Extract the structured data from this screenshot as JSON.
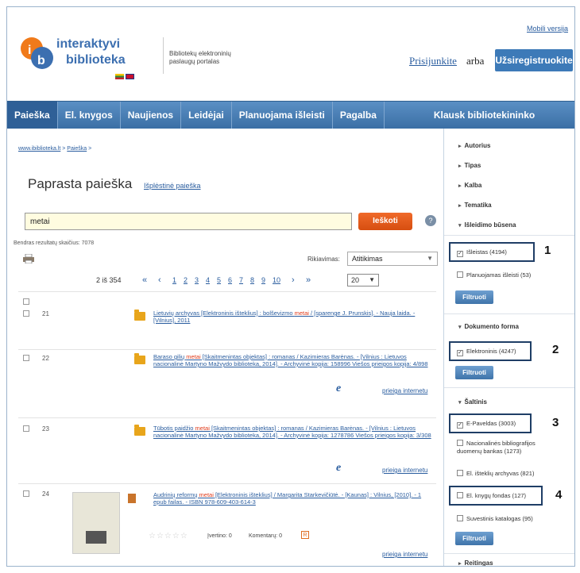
{
  "header": {
    "mobile_link": "Mobili versija",
    "logo_line1": "interaktyvi",
    "logo_line2": "biblioteka",
    "portal_text": "Bibliotekų elektroninių paslaugų portalas",
    "login_link": "Prisijunkite",
    "or_text": "arba",
    "register_button": "Užsiregistruokite"
  },
  "nav": {
    "items": [
      "Paieška",
      "El. knygos",
      "Naujienos",
      "Leidėjai",
      "Planuojama išleisti",
      "Pagalba",
      "Klausk bibliotekininko"
    ]
  },
  "breadcrumb": {
    "home": "www.ibiblioteka.lt",
    "sep": " > ",
    "current": "Paieška",
    "trail": " >"
  },
  "search": {
    "title": "Paprasta paieška",
    "advanced_link": "Išplėstinė paieška",
    "query": "metai",
    "button": "Ieškoti",
    "help": "?"
  },
  "results": {
    "total_label": "Bendras rezultatų skaičius: 7078",
    "sort_label": "Rikiavimas:",
    "sort_value": "Atitikimas",
    "pager": {
      "count": "2 iš 354",
      "first": "«",
      "prev": "‹",
      "pages": [
        "1",
        "2",
        "3",
        "4",
        "5",
        "6",
        "7",
        "8",
        "9",
        "10"
      ],
      "next": "›",
      "last": "»",
      "page_size": "20"
    },
    "rows": [
      {
        "num": "21",
        "text_before": "Lietuvių archyvas [Elektroninis išteklius] : bolševizmo ",
        "highlight": "metai",
        "text_after": " / [sparenge J. Prunskis]. - Nauja laida. - [Vilnius], 2011"
      },
      {
        "num": "22",
        "text_before": "Baraso gilių ",
        "highlight": "metai",
        "text_after": " [Skaitmenintas objektas] : romanas / Kazimieras Barėnas. - [Vilnius : Lietuvos nacionalinė Martyno Mažvydo biblioteka, 2014]. - Archyvinė kopija: 158996 Viešos prieigos kopija: 4/898",
        "source_logo": "Epaveldas",
        "net_link": "prieiga internetu"
      },
      {
        "num": "23",
        "text_before": "Tūbotis paidžio ",
        "highlight": "metai",
        "text_after": " [Skaitmenintas objektas] : romanas / Kazimieras Barėnas. - [Vilnius : Lietuvos nacionalinė Martyno Mažvydo biblioteka, 2014]. - Archyvinė kopija: 1278786 Viešos prieigos kopija: 3/308",
        "source_logo": "Epaveldas",
        "net_link": "prieiga internetu"
      },
      {
        "num": "24",
        "text_before": "Audrinių reformų ",
        "highlight": "metai",
        "text_after": " [Elektroninis išteklius] / Margarita Starkevičiūtė. - [Kaunas] : Vilnius, [2010]. - 1 epub failas. - ISBN 978-609-403-614-3",
        "rating_label": "Įvertino: 0",
        "comments_label": "Komentarų: 0",
        "net_link": "prieiga internetu"
      }
    ]
  },
  "sidebar": {
    "facets": [
      "Autorius",
      "Tipas",
      "Kalba",
      "Tematika"
    ],
    "status_title": "Išleidimo būsena",
    "status_options": [
      {
        "label": "Išleistas (4194)",
        "checked": true
      },
      {
        "label": "Planuojamas išleisti (53)",
        "checked": false
      }
    ],
    "filter_button": "Filtruoti",
    "form_title": "Dokumento forma",
    "form_options": [
      {
        "label": "Elektroninis (4247)",
        "checked": true
      }
    ],
    "source_title": "Šaltinis",
    "source_options": [
      {
        "label": "E-Paveldas (3003)",
        "checked": true
      },
      {
        "label": "Nacionalinės bibliografijos duomenų bankas (1273)",
        "checked": false
      },
      {
        "label": "El. išteklių archyvas (821)",
        "checked": false
      },
      {
        "label": "El. knygų fondas (127)",
        "checked": false
      },
      {
        "label": "Suvestinis katalogas (95)",
        "checked": false
      }
    ],
    "ratings_title": "Reitingas"
  },
  "callouts": [
    "1",
    "2",
    "3",
    "4"
  ]
}
